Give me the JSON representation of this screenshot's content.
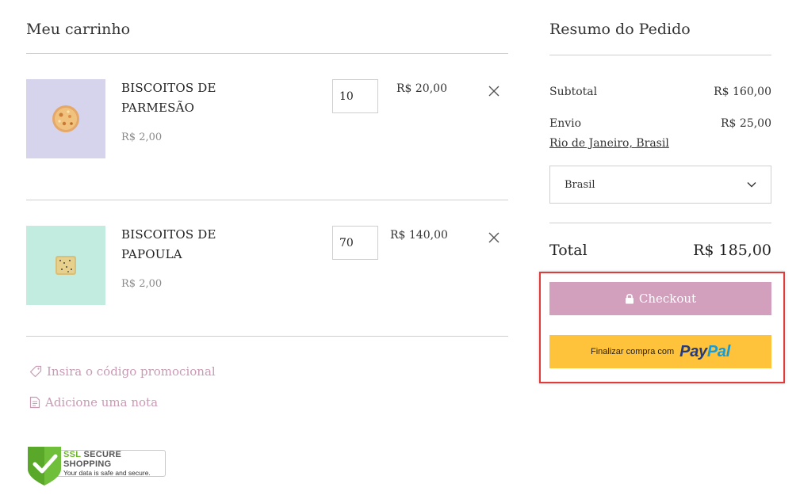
{
  "cart": {
    "title": "Meu carrinho",
    "items": [
      {
        "name_line1": "BISCOITOS DE",
        "name_line2": "PARMESÃO",
        "unit_price": "R$ 2,00",
        "quantity": "10",
        "line_total": "R$ 20,00",
        "thumb_bg": "#d6d4ec"
      },
      {
        "name_line1": "BISCOITOS DE",
        "name_line2": "PAPOULA",
        "unit_price": "R$ 2,00",
        "quantity": "70",
        "line_total": "R$ 140,00",
        "thumb_bg": "#c3ece1"
      }
    ],
    "promo_link": "Insira o código promocional",
    "note_link": "Adicione uma nota"
  },
  "summary": {
    "title": "Resumo do Pedido",
    "subtotal_label": "Subtotal",
    "subtotal_value": "R$ 160,00",
    "shipping_label": "Envio",
    "shipping_value": "R$ 25,00",
    "location_link": "Rio de Janeiro, Brasil",
    "country_selected": "Brasil",
    "total_label": "Total",
    "total_value": "R$ 185,00",
    "checkout_label": "Checkout",
    "paypal_text": "Finalizar compra com",
    "paypal_logo_1": "Pay",
    "paypal_logo_2": "Pal"
  },
  "badge": {
    "ssl": "SSL",
    "title": "SECURE SHOPPING",
    "subtitle": "Your data is safe and secure."
  },
  "colors": {
    "accent_pink": "#d29fbd",
    "link_pink": "#c99ab4",
    "paypal_yellow": "#fec33a",
    "highlight_red": "#e23b3b"
  }
}
